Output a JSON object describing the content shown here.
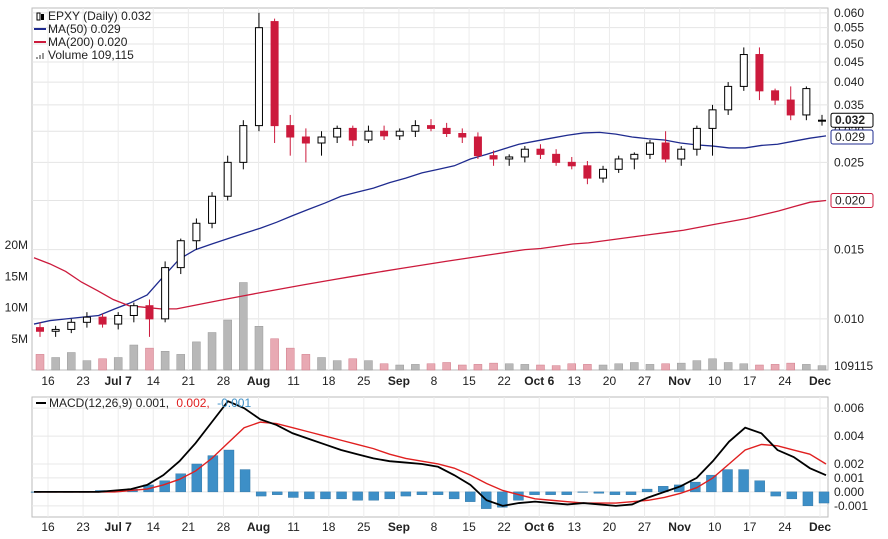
{
  "chart_data": [
    {
      "type": "candlestick",
      "symbol_label": "EPXY (Daily) 0.032",
      "y_scale": "log",
      "ylim": [
        0.0075,
        0.061
      ],
      "yticks": [
        "0.060",
        "0.055",
        "0.050",
        "0.045",
        "0.040",
        "0.035",
        "0.030",
        "0.025",
        "0.020",
        "0.015",
        "0.010"
      ],
      "volume_ticks": [
        "20M",
        "15M",
        "10M",
        "5M"
      ],
      "volume_max": 24000000,
      "x_ticks": [
        "16",
        "23",
        "Jul 7",
        "14",
        "21",
        "28",
        "Aug",
        "11",
        "18",
        "25",
        "Sep",
        "8",
        "15",
        "22",
        "Oct 6",
        "13",
        "20",
        "27",
        "Nov",
        "10",
        "17",
        "24",
        "Dec"
      ],
      "x_ticks_bold": [
        "Jul 7",
        "Aug",
        "Sep",
        "Oct 6",
        "Nov",
        "Dec"
      ],
      "legend": [
        {
          "label": "EPXY (Daily) 0.032",
          "color": "#000000",
          "icon": "candle-icon"
        },
        {
          "label": "MA(50) 0.029",
          "color": "#1f2b8f"
        },
        {
          "label": "MA(200) 0.020",
          "color": "#cc1a3c"
        },
        {
          "label": "Volume 109,115",
          "color": "#999999",
          "icon": "volume-icon"
        }
      ],
      "series": [
        {
          "name": "MA(50)",
          "color": "#1f2b8f",
          "values": [
            0.0097,
            0.0099,
            0.01,
            0.0101,
            0.0102,
            0.0106,
            0.011,
            0.0115,
            0.0128,
            0.0142,
            0.015,
            0.0155,
            0.016,
            0.0165,
            0.017,
            0.0176,
            0.0183,
            0.019,
            0.0197,
            0.0205,
            0.021,
            0.0215,
            0.0222,
            0.0228,
            0.0235,
            0.024,
            0.0245,
            0.0255,
            0.0262,
            0.027,
            0.0278,
            0.0283,
            0.0288,
            0.0293,
            0.0297,
            0.0298,
            0.0295,
            0.029,
            0.0287,
            0.0285,
            0.028,
            0.0277,
            0.0275,
            0.0272,
            0.0272,
            0.0276,
            0.0278,
            0.0283,
            0.0288,
            0.0292
          ]
        },
        {
          "name": "MA(200)",
          "color": "#cc1a3c",
          "values": [
            0.0143,
            0.0138,
            0.0132,
            0.0124,
            0.0118,
            0.0112,
            0.0108,
            0.0107,
            0.0106,
            0.0106,
            0.0108,
            0.011,
            0.0112,
            0.0114,
            0.0116,
            0.0118,
            0.012,
            0.0122,
            0.0124,
            0.0126,
            0.0128,
            0.013,
            0.0132,
            0.0134,
            0.0136,
            0.0138,
            0.014,
            0.0142,
            0.0144,
            0.0146,
            0.0148,
            0.015,
            0.0151,
            0.0153,
            0.0155,
            0.0156,
            0.0158,
            0.016,
            0.0162,
            0.0164,
            0.0166,
            0.0168,
            0.0171,
            0.0174,
            0.0177,
            0.018,
            0.0184,
            0.0188,
            0.0193,
            0.0198,
            0.02
          ]
        }
      ],
      "candles": [
        [
          0.0095,
          0.0098,
          0.009,
          0.0093
        ],
        [
          0.0093,
          0.0096,
          0.009,
          0.0094
        ],
        [
          0.0094,
          0.01,
          0.0092,
          0.0098
        ],
        [
          0.0098,
          0.0104,
          0.0095,
          0.0101
        ],
        [
          0.0101,
          0.0103,
          0.0095,
          0.0097
        ],
        [
          0.0097,
          0.0104,
          0.0094,
          0.0102
        ],
        [
          0.0102,
          0.011,
          0.0098,
          0.0108
        ],
        [
          0.0108,
          0.0112,
          0.009,
          0.01
        ],
        [
          0.01,
          0.014,
          0.0098,
          0.0135
        ],
        [
          0.0135,
          0.016,
          0.013,
          0.0158
        ],
        [
          0.0158,
          0.018,
          0.015,
          0.0175
        ],
        [
          0.0175,
          0.021,
          0.017,
          0.0205
        ],
        [
          0.0205,
          0.026,
          0.02,
          0.025
        ],
        [
          0.025,
          0.032,
          0.024,
          0.031
        ],
        [
          0.031,
          0.06,
          0.03,
          0.055
        ],
        [
          0.057,
          0.058,
          0.028,
          0.031
        ],
        [
          0.031,
          0.033,
          0.026,
          0.029
        ],
        [
          0.029,
          0.0305,
          0.025,
          0.028
        ],
        [
          0.028,
          0.03,
          0.026,
          0.029
        ],
        [
          0.029,
          0.031,
          0.028,
          0.0305
        ],
        [
          0.0305,
          0.031,
          0.0275,
          0.0285
        ],
        [
          0.0285,
          0.031,
          0.028,
          0.03
        ],
        [
          0.03,
          0.031,
          0.0285,
          0.0292
        ],
        [
          0.0292,
          0.0305,
          0.0285,
          0.03
        ],
        [
          0.03,
          0.032,
          0.029,
          0.031
        ],
        [
          0.031,
          0.0322,
          0.03,
          0.0305
        ],
        [
          0.0305,
          0.0315,
          0.029,
          0.0296
        ],
        [
          0.0296,
          0.0305,
          0.028,
          0.029
        ],
        [
          0.029,
          0.0298,
          0.0255,
          0.026
        ],
        [
          0.026,
          0.0268,
          0.0245,
          0.0255
        ],
        [
          0.0255,
          0.0262,
          0.0245,
          0.0258
        ],
        [
          0.0258,
          0.0275,
          0.025,
          0.027
        ],
        [
          0.027,
          0.0278,
          0.0255,
          0.0262
        ],
        [
          0.0262,
          0.027,
          0.0245,
          0.025
        ],
        [
          0.025,
          0.0258,
          0.024,
          0.0245
        ],
        [
          0.0245,
          0.0252,
          0.022,
          0.0228
        ],
        [
          0.0228,
          0.0245,
          0.0222,
          0.024
        ],
        [
          0.024,
          0.026,
          0.0235,
          0.0255
        ],
        [
          0.0255,
          0.0265,
          0.024,
          0.0262
        ],
        [
          0.0262,
          0.0285,
          0.0255,
          0.028
        ],
        [
          0.028,
          0.03,
          0.025,
          0.0255
        ],
        [
          0.0255,
          0.0275,
          0.0245,
          0.027
        ],
        [
          0.027,
          0.031,
          0.026,
          0.0305
        ],
        [
          0.0305,
          0.035,
          0.026,
          0.034
        ],
        [
          0.034,
          0.04,
          0.033,
          0.039
        ],
        [
          0.039,
          0.049,
          0.038,
          0.047
        ],
        [
          0.047,
          0.049,
          0.036,
          0.038
        ],
        [
          0.038,
          0.0385,
          0.035,
          0.036
        ],
        [
          0.036,
          0.039,
          0.032,
          0.033
        ],
        [
          0.033,
          0.039,
          0.032,
          0.0385
        ],
        [
          0.032,
          0.033,
          0.031,
          0.032
        ]
      ],
      "candle_up_color": "#000000",
      "candle_down_color": "#cc1a3c",
      "volume_values": [
        2.5,
        2.0,
        2.8,
        1.5,
        1.8,
        2.0,
        4.0,
        3.5,
        3.0,
        2.5,
        4.5,
        6.0,
        8.0,
        14.0,
        7.0,
        5.0,
        3.5,
        2.5,
        2.0,
        1.5,
        1.8,
        1.5,
        1.0,
        0.8,
        0.9,
        1.0,
        1.2,
        0.8,
        0.9,
        1.1,
        1.0,
        0.9,
        0.8,
        0.7,
        1.0,
        0.9,
        0.8,
        1.0,
        1.2,
        0.9,
        1.0,
        1.1,
        1.5,
        1.8,
        1.2,
        1.0,
        0.8,
        0.9,
        1.1,
        0.9,
        0.7
      ],
      "current_price_label": "0.032",
      "ma50_label": "0.029",
      "ma200_label": "0.020",
      "volume_label": "109115"
    },
    {
      "type": "macd",
      "legend_text": "MACD(12,26,9) 0.001,",
      "legend_signal": "0.002,",
      "legend_hist": "-0.001",
      "macd_color": "#000000",
      "signal_color": "#e02020",
      "hist_color": "#3d8fc7",
      "ylim": [
        -0.0018,
        0.0068
      ],
      "yticks": [
        "0.006",
        "0.004",
        "0.002",
        "0.001",
        "0.000",
        "-0.001"
      ],
      "macd_values": [
        0.0,
        0.0,
        0.0,
        0.0,
        0.0,
        0.0001,
        0.0002,
        0.0005,
        0.0012,
        0.0022,
        0.0035,
        0.005,
        0.0065,
        0.006,
        0.0052,
        0.0048,
        0.0042,
        0.0038,
        0.0034,
        0.003,
        0.0027,
        0.0024,
        0.0022,
        0.0021,
        0.002,
        0.0018,
        0.0012,
        0.0005,
        -0.0006,
        -0.001,
        -0.0008,
        -0.0007,
        -0.0008,
        -0.0009,
        -0.0008,
        -0.0009,
        -0.001,
        -0.0009,
        -0.0004,
        0.0,
        0.0004,
        0.001,
        0.0022,
        0.0036,
        0.0046,
        0.0042,
        0.003,
        0.0025,
        0.0017,
        0.0012
      ],
      "signal_values": [
        0.0,
        0.0,
        0.0,
        0.0,
        0.0,
        0.0,
        0.0001,
        0.0002,
        0.0005,
        0.0009,
        0.0015,
        0.0024,
        0.0035,
        0.0046,
        0.005,
        0.0049,
        0.0046,
        0.0043,
        0.004,
        0.0037,
        0.0034,
        0.0031,
        0.0027,
        0.0024,
        0.0022,
        0.002,
        0.0017,
        0.0012,
        0.0006,
        0.0001,
        -0.0002,
        -0.0005,
        -0.0006,
        -0.0007,
        -0.0008,
        -0.0008,
        -0.0008,
        -0.0007,
        -0.0006,
        -0.0004,
        -0.0001,
        0.0003,
        0.001,
        0.002,
        0.003,
        0.0034,
        0.0033,
        0.003,
        0.0027,
        0.002
      ],
      "hist_values": [
        0.0,
        0.0,
        0.0,
        0.0,
        0.0001,
        0.0001,
        0.0002,
        0.0005,
        0.0008,
        0.0013,
        0.002,
        0.0026,
        0.003,
        0.0016,
        -0.0003,
        -0.0002,
        -0.0004,
        -0.0005,
        -0.0005,
        -0.0005,
        -0.0006,
        -0.0006,
        -0.0005,
        -0.0003,
        -0.0002,
        -0.0002,
        -0.0005,
        -0.0007,
        -0.0012,
        -0.0011,
        -0.0006,
        -0.0002,
        -0.0002,
        -0.0002,
        0.0,
        -0.0001,
        -0.0002,
        -0.0002,
        0.0002,
        0.0004,
        0.0005,
        0.0007,
        0.0012,
        0.0016,
        0.0016,
        0.0008,
        -0.0003,
        -0.0005,
        -0.001,
        -0.0008
      ]
    }
  ]
}
